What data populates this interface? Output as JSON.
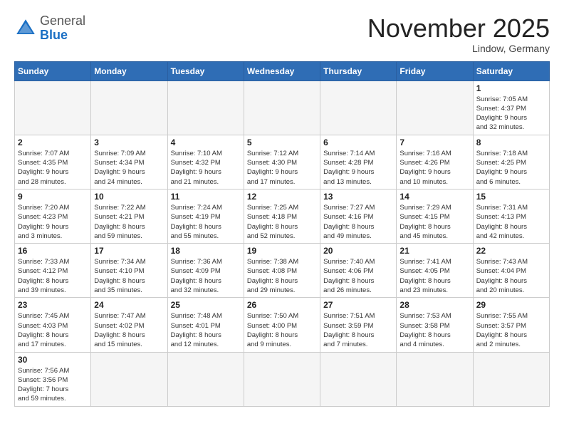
{
  "header": {
    "logo_general": "General",
    "logo_blue": "Blue",
    "month_title": "November 2025",
    "location": "Lindow, Germany"
  },
  "weekdays": [
    "Sunday",
    "Monday",
    "Tuesday",
    "Wednesday",
    "Thursday",
    "Friday",
    "Saturday"
  ],
  "days": [
    {
      "num": "",
      "info": "",
      "empty": true
    },
    {
      "num": "",
      "info": "",
      "empty": true
    },
    {
      "num": "",
      "info": "",
      "empty": true
    },
    {
      "num": "",
      "info": "",
      "empty": true
    },
    {
      "num": "",
      "info": "",
      "empty": true
    },
    {
      "num": "",
      "info": "",
      "empty": true
    },
    {
      "num": "1",
      "info": "Sunrise: 7:05 AM\nSunset: 4:37 PM\nDaylight: 9 hours\nand 32 minutes."
    },
    {
      "num": "2",
      "info": "Sunrise: 7:07 AM\nSunset: 4:35 PM\nDaylight: 9 hours\nand 28 minutes."
    },
    {
      "num": "3",
      "info": "Sunrise: 7:09 AM\nSunset: 4:34 PM\nDaylight: 9 hours\nand 24 minutes."
    },
    {
      "num": "4",
      "info": "Sunrise: 7:10 AM\nSunset: 4:32 PM\nDaylight: 9 hours\nand 21 minutes."
    },
    {
      "num": "5",
      "info": "Sunrise: 7:12 AM\nSunset: 4:30 PM\nDaylight: 9 hours\nand 17 minutes."
    },
    {
      "num": "6",
      "info": "Sunrise: 7:14 AM\nSunset: 4:28 PM\nDaylight: 9 hours\nand 13 minutes."
    },
    {
      "num": "7",
      "info": "Sunrise: 7:16 AM\nSunset: 4:26 PM\nDaylight: 9 hours\nand 10 minutes."
    },
    {
      "num": "8",
      "info": "Sunrise: 7:18 AM\nSunset: 4:25 PM\nDaylight: 9 hours\nand 6 minutes."
    },
    {
      "num": "9",
      "info": "Sunrise: 7:20 AM\nSunset: 4:23 PM\nDaylight: 9 hours\nand 3 minutes."
    },
    {
      "num": "10",
      "info": "Sunrise: 7:22 AM\nSunset: 4:21 PM\nDaylight: 8 hours\nand 59 minutes."
    },
    {
      "num": "11",
      "info": "Sunrise: 7:24 AM\nSunset: 4:19 PM\nDaylight: 8 hours\nand 55 minutes."
    },
    {
      "num": "12",
      "info": "Sunrise: 7:25 AM\nSunset: 4:18 PM\nDaylight: 8 hours\nand 52 minutes."
    },
    {
      "num": "13",
      "info": "Sunrise: 7:27 AM\nSunset: 4:16 PM\nDaylight: 8 hours\nand 49 minutes."
    },
    {
      "num": "14",
      "info": "Sunrise: 7:29 AM\nSunset: 4:15 PM\nDaylight: 8 hours\nand 45 minutes."
    },
    {
      "num": "15",
      "info": "Sunrise: 7:31 AM\nSunset: 4:13 PM\nDaylight: 8 hours\nand 42 minutes."
    },
    {
      "num": "16",
      "info": "Sunrise: 7:33 AM\nSunset: 4:12 PM\nDaylight: 8 hours\nand 39 minutes."
    },
    {
      "num": "17",
      "info": "Sunrise: 7:34 AM\nSunset: 4:10 PM\nDaylight: 8 hours\nand 35 minutes."
    },
    {
      "num": "18",
      "info": "Sunrise: 7:36 AM\nSunset: 4:09 PM\nDaylight: 8 hours\nand 32 minutes."
    },
    {
      "num": "19",
      "info": "Sunrise: 7:38 AM\nSunset: 4:08 PM\nDaylight: 8 hours\nand 29 minutes."
    },
    {
      "num": "20",
      "info": "Sunrise: 7:40 AM\nSunset: 4:06 PM\nDaylight: 8 hours\nand 26 minutes."
    },
    {
      "num": "21",
      "info": "Sunrise: 7:41 AM\nSunset: 4:05 PM\nDaylight: 8 hours\nand 23 minutes."
    },
    {
      "num": "22",
      "info": "Sunrise: 7:43 AM\nSunset: 4:04 PM\nDaylight: 8 hours\nand 20 minutes."
    },
    {
      "num": "23",
      "info": "Sunrise: 7:45 AM\nSunset: 4:03 PM\nDaylight: 8 hours\nand 17 minutes."
    },
    {
      "num": "24",
      "info": "Sunrise: 7:47 AM\nSunset: 4:02 PM\nDaylight: 8 hours\nand 15 minutes."
    },
    {
      "num": "25",
      "info": "Sunrise: 7:48 AM\nSunset: 4:01 PM\nDaylight: 8 hours\nand 12 minutes."
    },
    {
      "num": "26",
      "info": "Sunrise: 7:50 AM\nSunset: 4:00 PM\nDaylight: 8 hours\nand 9 minutes."
    },
    {
      "num": "27",
      "info": "Sunrise: 7:51 AM\nSunset: 3:59 PM\nDaylight: 8 hours\nand 7 minutes."
    },
    {
      "num": "28",
      "info": "Sunrise: 7:53 AM\nSunset: 3:58 PM\nDaylight: 8 hours\nand 4 minutes."
    },
    {
      "num": "29",
      "info": "Sunrise: 7:55 AM\nSunset: 3:57 PM\nDaylight: 8 hours\nand 2 minutes."
    },
    {
      "num": "30",
      "info": "Sunrise: 7:56 AM\nSunset: 3:56 PM\nDaylight: 7 hours\nand 59 minutes."
    },
    {
      "num": "",
      "info": "",
      "empty": true
    },
    {
      "num": "",
      "info": "",
      "empty": true
    },
    {
      "num": "",
      "info": "",
      "empty": true
    },
    {
      "num": "",
      "info": "",
      "empty": true
    },
    {
      "num": "",
      "info": "",
      "empty": true
    },
    {
      "num": "",
      "info": "",
      "empty": true
    }
  ]
}
